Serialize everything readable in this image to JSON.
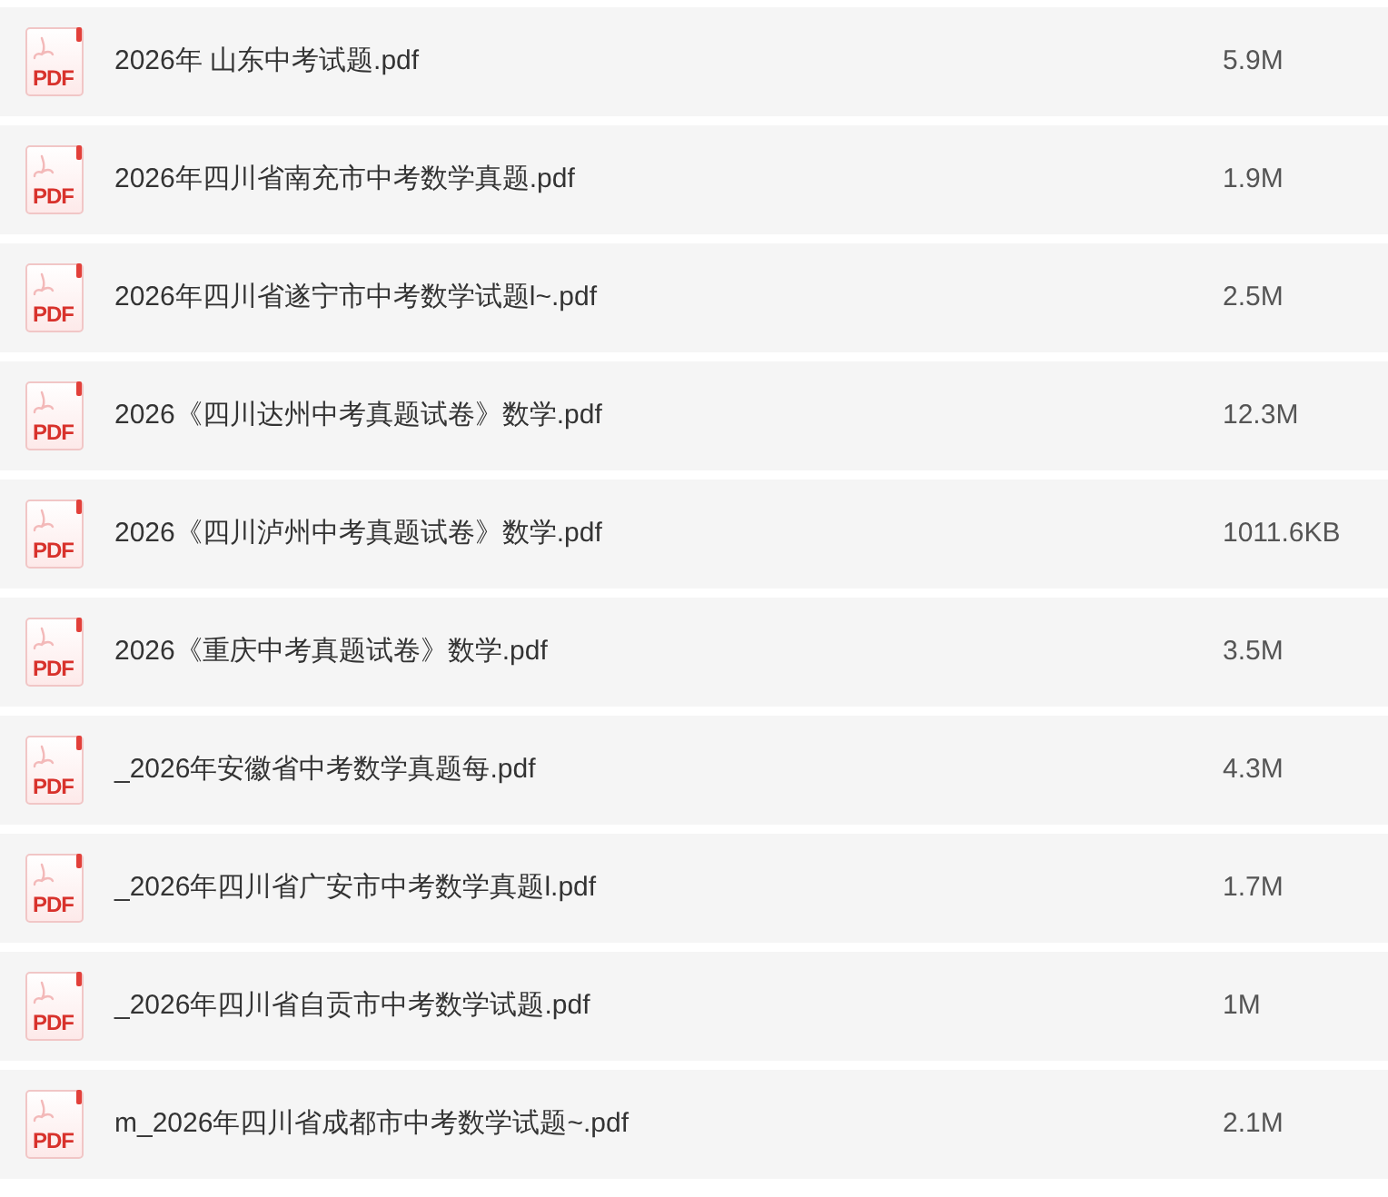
{
  "files": [
    {
      "name": "2026年 山东中考试题.pdf",
      "size": "5.9M",
      "icon_label": "PDF"
    },
    {
      "name": "2026年四川省南充市中考数学真题.pdf",
      "size": "1.9M",
      "icon_label": "PDF"
    },
    {
      "name": "2026年四川省遂宁市中考数学试题l~.pdf",
      "size": "2.5M",
      "icon_label": "PDF"
    },
    {
      "name": "2026《四川达州中考真题试卷》数学.pdf",
      "size": "12.3M",
      "icon_label": "PDF"
    },
    {
      "name": "2026《四川泸州中考真题试卷》数学.pdf",
      "size": "1011.6KB",
      "icon_label": "PDF"
    },
    {
      "name": "2026《重庆中考真题试卷》数学.pdf",
      "size": "3.5M",
      "icon_label": "PDF"
    },
    {
      "name": "_2026年安徽省中考数学真题每.pdf",
      "size": "4.3M",
      "icon_label": "PDF"
    },
    {
      "name": "_2026年四川省广安市中考数学真题l.pdf",
      "size": "1.7M",
      "icon_label": "PDF"
    },
    {
      "name": "_2026年四川省自贡市中考数学试题.pdf",
      "size": "1M",
      "icon_label": "PDF"
    },
    {
      "name": "m_2026年四川省成都市中考数学试题~.pdf",
      "size": "2.1M",
      "icon_label": "PDF"
    }
  ]
}
